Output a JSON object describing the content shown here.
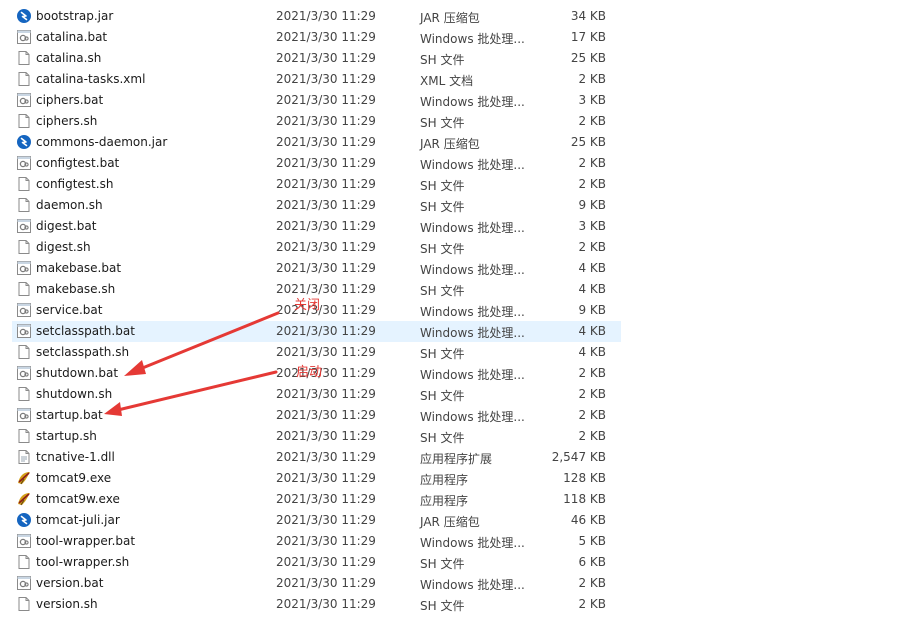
{
  "files": [
    {
      "name": "bootstrap.jar",
      "date": "2021/3/30 11:29",
      "type": "JAR 压缩包",
      "size": "34 KB",
      "icon": "jar-icon"
    },
    {
      "name": "catalina.bat",
      "date": "2021/3/30 11:29",
      "type": "Windows 批处理...",
      "size": "17 KB",
      "icon": "bat-icon"
    },
    {
      "name": "catalina.sh",
      "date": "2021/3/30 11:29",
      "type": "SH 文件",
      "size": "25 KB",
      "icon": "file-icon"
    },
    {
      "name": "catalina-tasks.xml",
      "date": "2021/3/30 11:29",
      "type": "XML 文档",
      "size": "2 KB",
      "icon": "file-icon"
    },
    {
      "name": "ciphers.bat",
      "date": "2021/3/30 11:29",
      "type": "Windows 批处理...",
      "size": "3 KB",
      "icon": "bat-icon"
    },
    {
      "name": "ciphers.sh",
      "date": "2021/3/30 11:29",
      "type": "SH 文件",
      "size": "2 KB",
      "icon": "file-icon"
    },
    {
      "name": "commons-daemon.jar",
      "date": "2021/3/30 11:29",
      "type": "JAR 压缩包",
      "size": "25 KB",
      "icon": "jar-icon"
    },
    {
      "name": "configtest.bat",
      "date": "2021/3/30 11:29",
      "type": "Windows 批处理...",
      "size": "2 KB",
      "icon": "bat-icon"
    },
    {
      "name": "configtest.sh",
      "date": "2021/3/30 11:29",
      "type": "SH 文件",
      "size": "2 KB",
      "icon": "file-icon"
    },
    {
      "name": "daemon.sh",
      "date": "2021/3/30 11:29",
      "type": "SH 文件",
      "size": "9 KB",
      "icon": "file-icon"
    },
    {
      "name": "digest.bat",
      "date": "2021/3/30 11:29",
      "type": "Windows 批处理...",
      "size": "3 KB",
      "icon": "bat-icon"
    },
    {
      "name": "digest.sh",
      "date": "2021/3/30 11:29",
      "type": "SH 文件",
      "size": "2 KB",
      "icon": "file-icon"
    },
    {
      "name": "makebase.bat",
      "date": "2021/3/30 11:29",
      "type": "Windows 批处理...",
      "size": "4 KB",
      "icon": "bat-icon"
    },
    {
      "name": "makebase.sh",
      "date": "2021/3/30 11:29",
      "type": "SH 文件",
      "size": "4 KB",
      "icon": "file-icon"
    },
    {
      "name": "service.bat",
      "date": "2021/3/30 11:29",
      "type": "Windows 批处理...",
      "size": "9 KB",
      "icon": "bat-icon"
    },
    {
      "name": "setclasspath.bat",
      "date": "2021/3/30 11:29",
      "type": "Windows 批处理...",
      "size": "4 KB",
      "icon": "bat-icon",
      "selected": true
    },
    {
      "name": "setclasspath.sh",
      "date": "2021/3/30 11:29",
      "type": "SH 文件",
      "size": "4 KB",
      "icon": "file-icon"
    },
    {
      "name": "shutdown.bat",
      "date": "2021/3/30 11:29",
      "type": "Windows 批处理...",
      "size": "2 KB",
      "icon": "bat-icon"
    },
    {
      "name": "shutdown.sh",
      "date": "2021/3/30 11:29",
      "type": "SH 文件",
      "size": "2 KB",
      "icon": "file-icon"
    },
    {
      "name": "startup.bat",
      "date": "2021/3/30 11:29",
      "type": "Windows 批处理...",
      "size": "2 KB",
      "icon": "bat-icon"
    },
    {
      "name": "startup.sh",
      "date": "2021/3/30 11:29",
      "type": "SH 文件",
      "size": "2 KB",
      "icon": "file-icon"
    },
    {
      "name": "tcnative-1.dll",
      "date": "2021/3/30 11:29",
      "type": "应用程序扩展",
      "size": "2,547 KB",
      "icon": "dll-icon"
    },
    {
      "name": "tomcat9.exe",
      "date": "2021/3/30 11:29",
      "type": "应用程序",
      "size": "128 KB",
      "icon": "tomcat-exe-icon"
    },
    {
      "name": "tomcat9w.exe",
      "date": "2021/3/30 11:29",
      "type": "应用程序",
      "size": "118 KB",
      "icon": "tomcat-exe-icon"
    },
    {
      "name": "tomcat-juli.jar",
      "date": "2021/3/30 11:29",
      "type": "JAR 压缩包",
      "size": "46 KB",
      "icon": "jar-icon"
    },
    {
      "name": "tool-wrapper.bat",
      "date": "2021/3/30 11:29",
      "type": "Windows 批处理...",
      "size": "5 KB",
      "icon": "bat-icon"
    },
    {
      "name": "tool-wrapper.sh",
      "date": "2021/3/30 11:29",
      "type": "SH 文件",
      "size": "6 KB",
      "icon": "file-icon"
    },
    {
      "name": "version.bat",
      "date": "2021/3/30 11:29",
      "type": "Windows 批处理...",
      "size": "2 KB",
      "icon": "bat-icon"
    },
    {
      "name": "version.sh",
      "date": "2021/3/30 11:29",
      "type": "SH 文件",
      "size": "2 KB",
      "icon": "file-icon"
    }
  ],
  "annotations": {
    "shutdown_label": "关闭",
    "startup_label": "启动",
    "color": "#e53935"
  }
}
